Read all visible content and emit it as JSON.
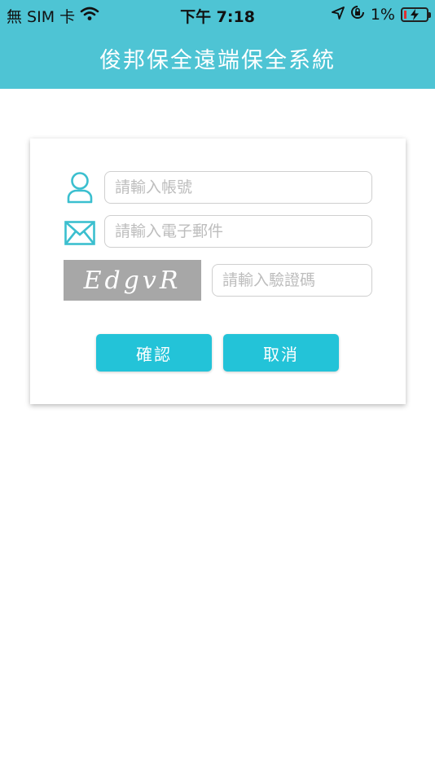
{
  "status_bar": {
    "carrier": "無 SIM 卡",
    "time": "下午 7:18",
    "battery_percent": "1%",
    "icons": [
      "wifi-icon",
      "location-arrow-icon",
      "orientation-lock-icon",
      "battery-charging-icon"
    ]
  },
  "header": {
    "title": "俊邦保全遠端保全系統"
  },
  "form": {
    "account_placeholder": "請輸入帳號",
    "email_placeholder": "請輸入電子郵件",
    "captcha_text": "EdgvR",
    "captcha_placeholder": "請輸入驗證碼",
    "confirm_label": "確認",
    "cancel_label": "取消"
  },
  "colors": {
    "header_bg": "#4ec4d4",
    "button_bg": "#23c3d8",
    "icon": "#3bbfcf",
    "captcha_bg": "#a7a7a7"
  }
}
